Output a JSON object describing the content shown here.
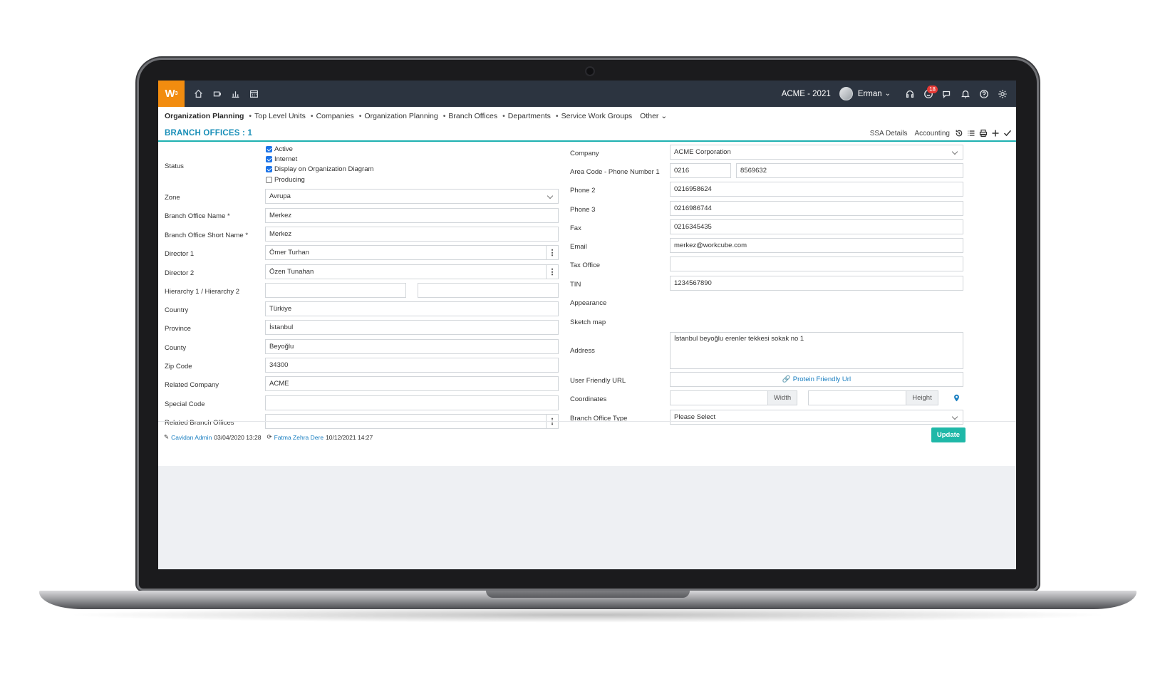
{
  "topbar": {
    "logo": "W",
    "logo_sup": "3",
    "org": "ACME - 2021",
    "user": "Erman",
    "notif_badge": "18"
  },
  "breadcrumb": {
    "first": "Organization Planning",
    "items": [
      "Top Level Units",
      "Companies",
      "Organization Planning",
      "Branch Offices",
      "Departments",
      "Service Work Groups"
    ],
    "other": "Other"
  },
  "panel": {
    "title": "BRANCH OFFICES : 1",
    "actions": [
      "SSA Details",
      "Accounting"
    ]
  },
  "left": {
    "status_label": "Status",
    "status_checks": [
      {
        "label": "Active",
        "checked": true
      },
      {
        "label": "Internet",
        "checked": true
      },
      {
        "label": "Display on Organization Diagram",
        "checked": true
      },
      {
        "label": "Producing",
        "checked": false
      }
    ],
    "zone_label": "Zone",
    "zone_value": "Avrupa",
    "name_label": "Branch Office Name *",
    "name_value": "Merkez",
    "short_label": "Branch Office Short Name *",
    "short_value": "Merkez",
    "dir1_label": "Director 1",
    "dir1_value": "Ömer Turhan",
    "dir2_label": "Director 2",
    "dir2_value": "Özen Tunahan",
    "hier_label": "Hierarchy 1 / Hierarchy 2",
    "country_label": "Country",
    "country_value": "Türkiye",
    "province_label": "Province",
    "province_value": "İstanbul",
    "county_label": "County",
    "county_value": "Beyoğlu",
    "zip_label": "Zip Code",
    "zip_value": "34300",
    "relco_label": "Related Company",
    "relco_value": "ACME",
    "special_label": "Special Code",
    "relbranch_label": "Related Branch Offices"
  },
  "right": {
    "company_label": "Company",
    "company_value": "ACME Corporation",
    "phone1_label": "Area Code - Phone Number 1",
    "area_code": "0216",
    "phone1": "8569632",
    "phone2_label": "Phone 2",
    "phone2": "0216958624",
    "phone3_label": "Phone 3",
    "phone3": "0216986744",
    "fax_label": "Fax",
    "fax": "0216345435",
    "email_label": "Email",
    "email": "merkez@workcube.com",
    "tax_label": "Tax Office",
    "tin_label": "TIN",
    "tin": "1234567890",
    "appearance_label": "Appearance",
    "sketch_label": "Sketch map",
    "address_label": "Address",
    "address": "İstanbul beyoğlu erenler tekkesi sokak no 1",
    "url_label": "User Friendly URL",
    "url_link": "Protein Friendly Url",
    "coord_label": "Coordinates",
    "width_label": "Width",
    "height_label": "Height",
    "type_label": "Branch Office Type",
    "type_value": "Please Select"
  },
  "footer": {
    "creator": "Cavidan Admin",
    "created": "03/04/2020 13:28",
    "updater": "Fatma Zehra Dere",
    "updated": "10/12/2021 14:27",
    "update_button": "Update"
  }
}
